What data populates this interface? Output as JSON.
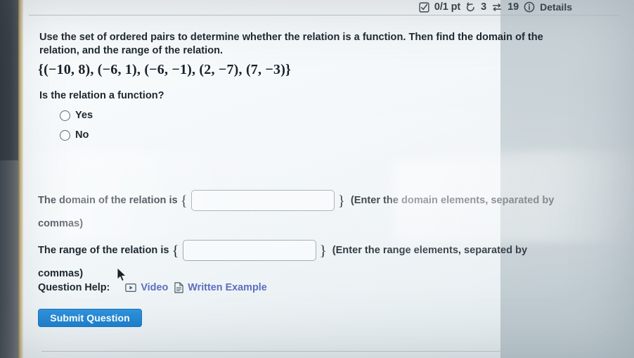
{
  "statusbar": {
    "score": "0/1 pt",
    "attempts": "3",
    "views": "19",
    "details_label": "Details",
    "score_icon": "checked-box-icon",
    "attempts_icon": "undo-circular-arrow-icon",
    "views_icon": "exchange-arrows-icon",
    "details_icon": "info-circle-icon"
  },
  "question": {
    "prompt": "Use the set of ordered pairs to determine whether the relation is a function. Then find the domain of the relation, and the range of the relation.",
    "ordered_pairs": "{(−10, 8), (−6, 1), (−6, −1), (2, −7), (7, −3)}",
    "sub_question": "Is the relation a function?",
    "options": [
      {
        "label": "Yes",
        "selected": false
      },
      {
        "label": "No",
        "selected": false
      }
    ]
  },
  "answers": {
    "domain": {
      "label": "The domain of the relation is",
      "open_brace": "{",
      "close_brace": "}",
      "value": "",
      "placeholder": "",
      "hint": "(Enter the domain elements, separated by",
      "hint_continued": "commas)"
    },
    "range": {
      "label": "The range of the relation is",
      "open_brace": "{",
      "close_brace": "}",
      "value": "",
      "placeholder": "",
      "hint": "(Enter the range elements, separated by",
      "hint_continued": "commas)"
    }
  },
  "help": {
    "label": "Question Help:",
    "video_label": "Video",
    "video_icon": "video-play-icon",
    "written_label": "Written Example",
    "written_icon": "document-page-icon"
  },
  "actions": {
    "submit_label": "Submit Question"
  },
  "colors": {
    "accent_blue": "#1b7fcd",
    "link_blue": "#5b6fc0",
    "text": "#1d2830",
    "input_border": "#9aa9b2",
    "page_bg": "#f4f8fa"
  }
}
